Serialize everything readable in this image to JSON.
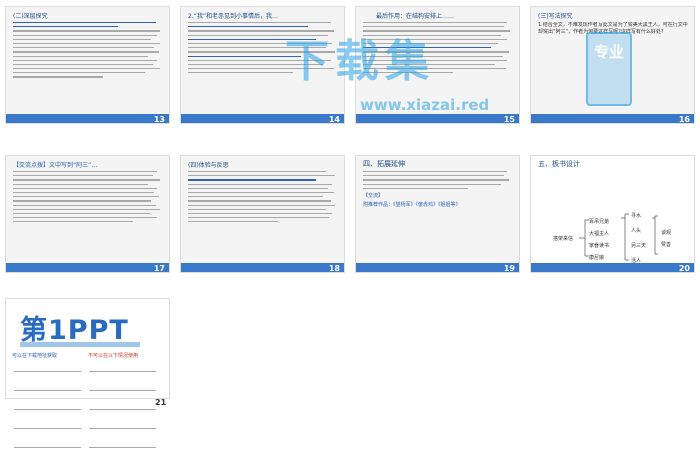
{
  "slides": [
    {
      "num": "13",
      "title": "(二)深层探究"
    },
    {
      "num": "14",
      "title": "2.“我”和老赤见到小事情后，我…"
    },
    {
      "num": "15",
      "title": "最后作用：在结构安排上……"
    },
    {
      "num": "16",
      "title": "(三)写法探究"
    },
    {
      "num": "17",
      "title": "【交流点拨】文中写到“阿三”…"
    },
    {
      "num": "18",
      "title": "(四)体验与反思"
    },
    {
      "num": "19",
      "title": "四、拓展延伸"
    },
    {
      "num": "20",
      "title": "五、板书设计"
    },
    {
      "num": "21",
      "title": ""
    }
  ],
  "slide16_text": "1.结合全文，不难发现作者写此文是为了赞美大黑王人，可在行文中却突出“阿三”，作者为何要这样写呢?这样写有什么好处?",
  "slide19_note": "【交流】",
  "slide19_ref": "附推荐作品：《望杨军》《傻赤鸡》《姐姐等》",
  "board": {
    "center": "搭架来信",
    "left": [
      "百吊兄弟",
      "大福主人",
      "家眷读书",
      "康尼娘"
    ],
    "right1": [
      "寻水",
      "人头",
      "另三天",
      "活人"
    ],
    "right2": [
      "谈观",
      "赞善"
    ]
  },
  "logo_text": "第1PPT",
  "logo_caption_a": "可以在下载地址获取",
  "logo_caption_b": "不可以在以下情况使用",
  "watermark": {
    "big": "下载集",
    "url": "www.xiazai.red",
    "badge": "专业"
  }
}
